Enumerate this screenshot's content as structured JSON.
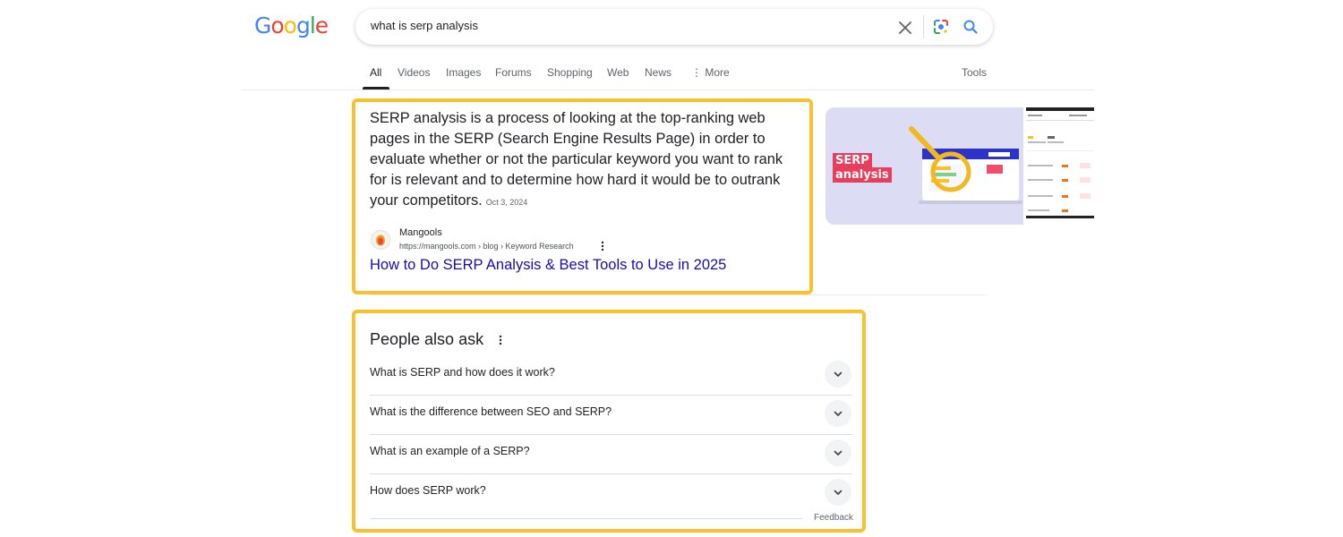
{
  "logo": {
    "letters": [
      "G",
      "o",
      "o",
      "g",
      "l",
      "e"
    ]
  },
  "search": {
    "query": "what is serp analysis"
  },
  "tabs": [
    {
      "label": "All",
      "active": true
    },
    {
      "label": "Videos"
    },
    {
      "label": "Images"
    },
    {
      "label": "Forums"
    },
    {
      "label": "Shopping"
    },
    {
      "label": "Web"
    },
    {
      "label": "News"
    },
    {
      "label": "⋮ More"
    }
  ],
  "tools_label": "Tools",
  "featured_snippet": {
    "text": "SERP analysis is a process of looking at the top-ranking web pages in the SERP (Search Engine Results Page) in order to evaluate whether or not the particular keyword you want to rank for is relevant and to determine how hard it would be to outrank your competitors.",
    "date": "Oct 3, 2024",
    "source_name": "Mangools",
    "source_url": "https://mangools.com › blog › Keyword Research",
    "title": "How to Do SERP Analysis & Best Tools to Use in 2025",
    "thumbnail_label_line1": "SERP",
    "thumbnail_label_line2": "analysis"
  },
  "people_also_ask": {
    "title": "People also ask",
    "questions": [
      "What is SERP and how does it work?",
      "What is the difference between SEO and SERP?",
      "What is an example of a SERP?",
      "How does SERP work?"
    ],
    "feedback_label": "Feedback"
  },
  "colors": {
    "highlight": "#f9c12d",
    "link": "#1a0dab",
    "thumbnail_accent": "#e83e5c"
  },
  "icons": {
    "clear": "close-icon",
    "lens": "google-lens-icon",
    "search": "search-icon",
    "more_menu": "vertical-dots-icon",
    "expand": "chevron-down-icon"
  }
}
